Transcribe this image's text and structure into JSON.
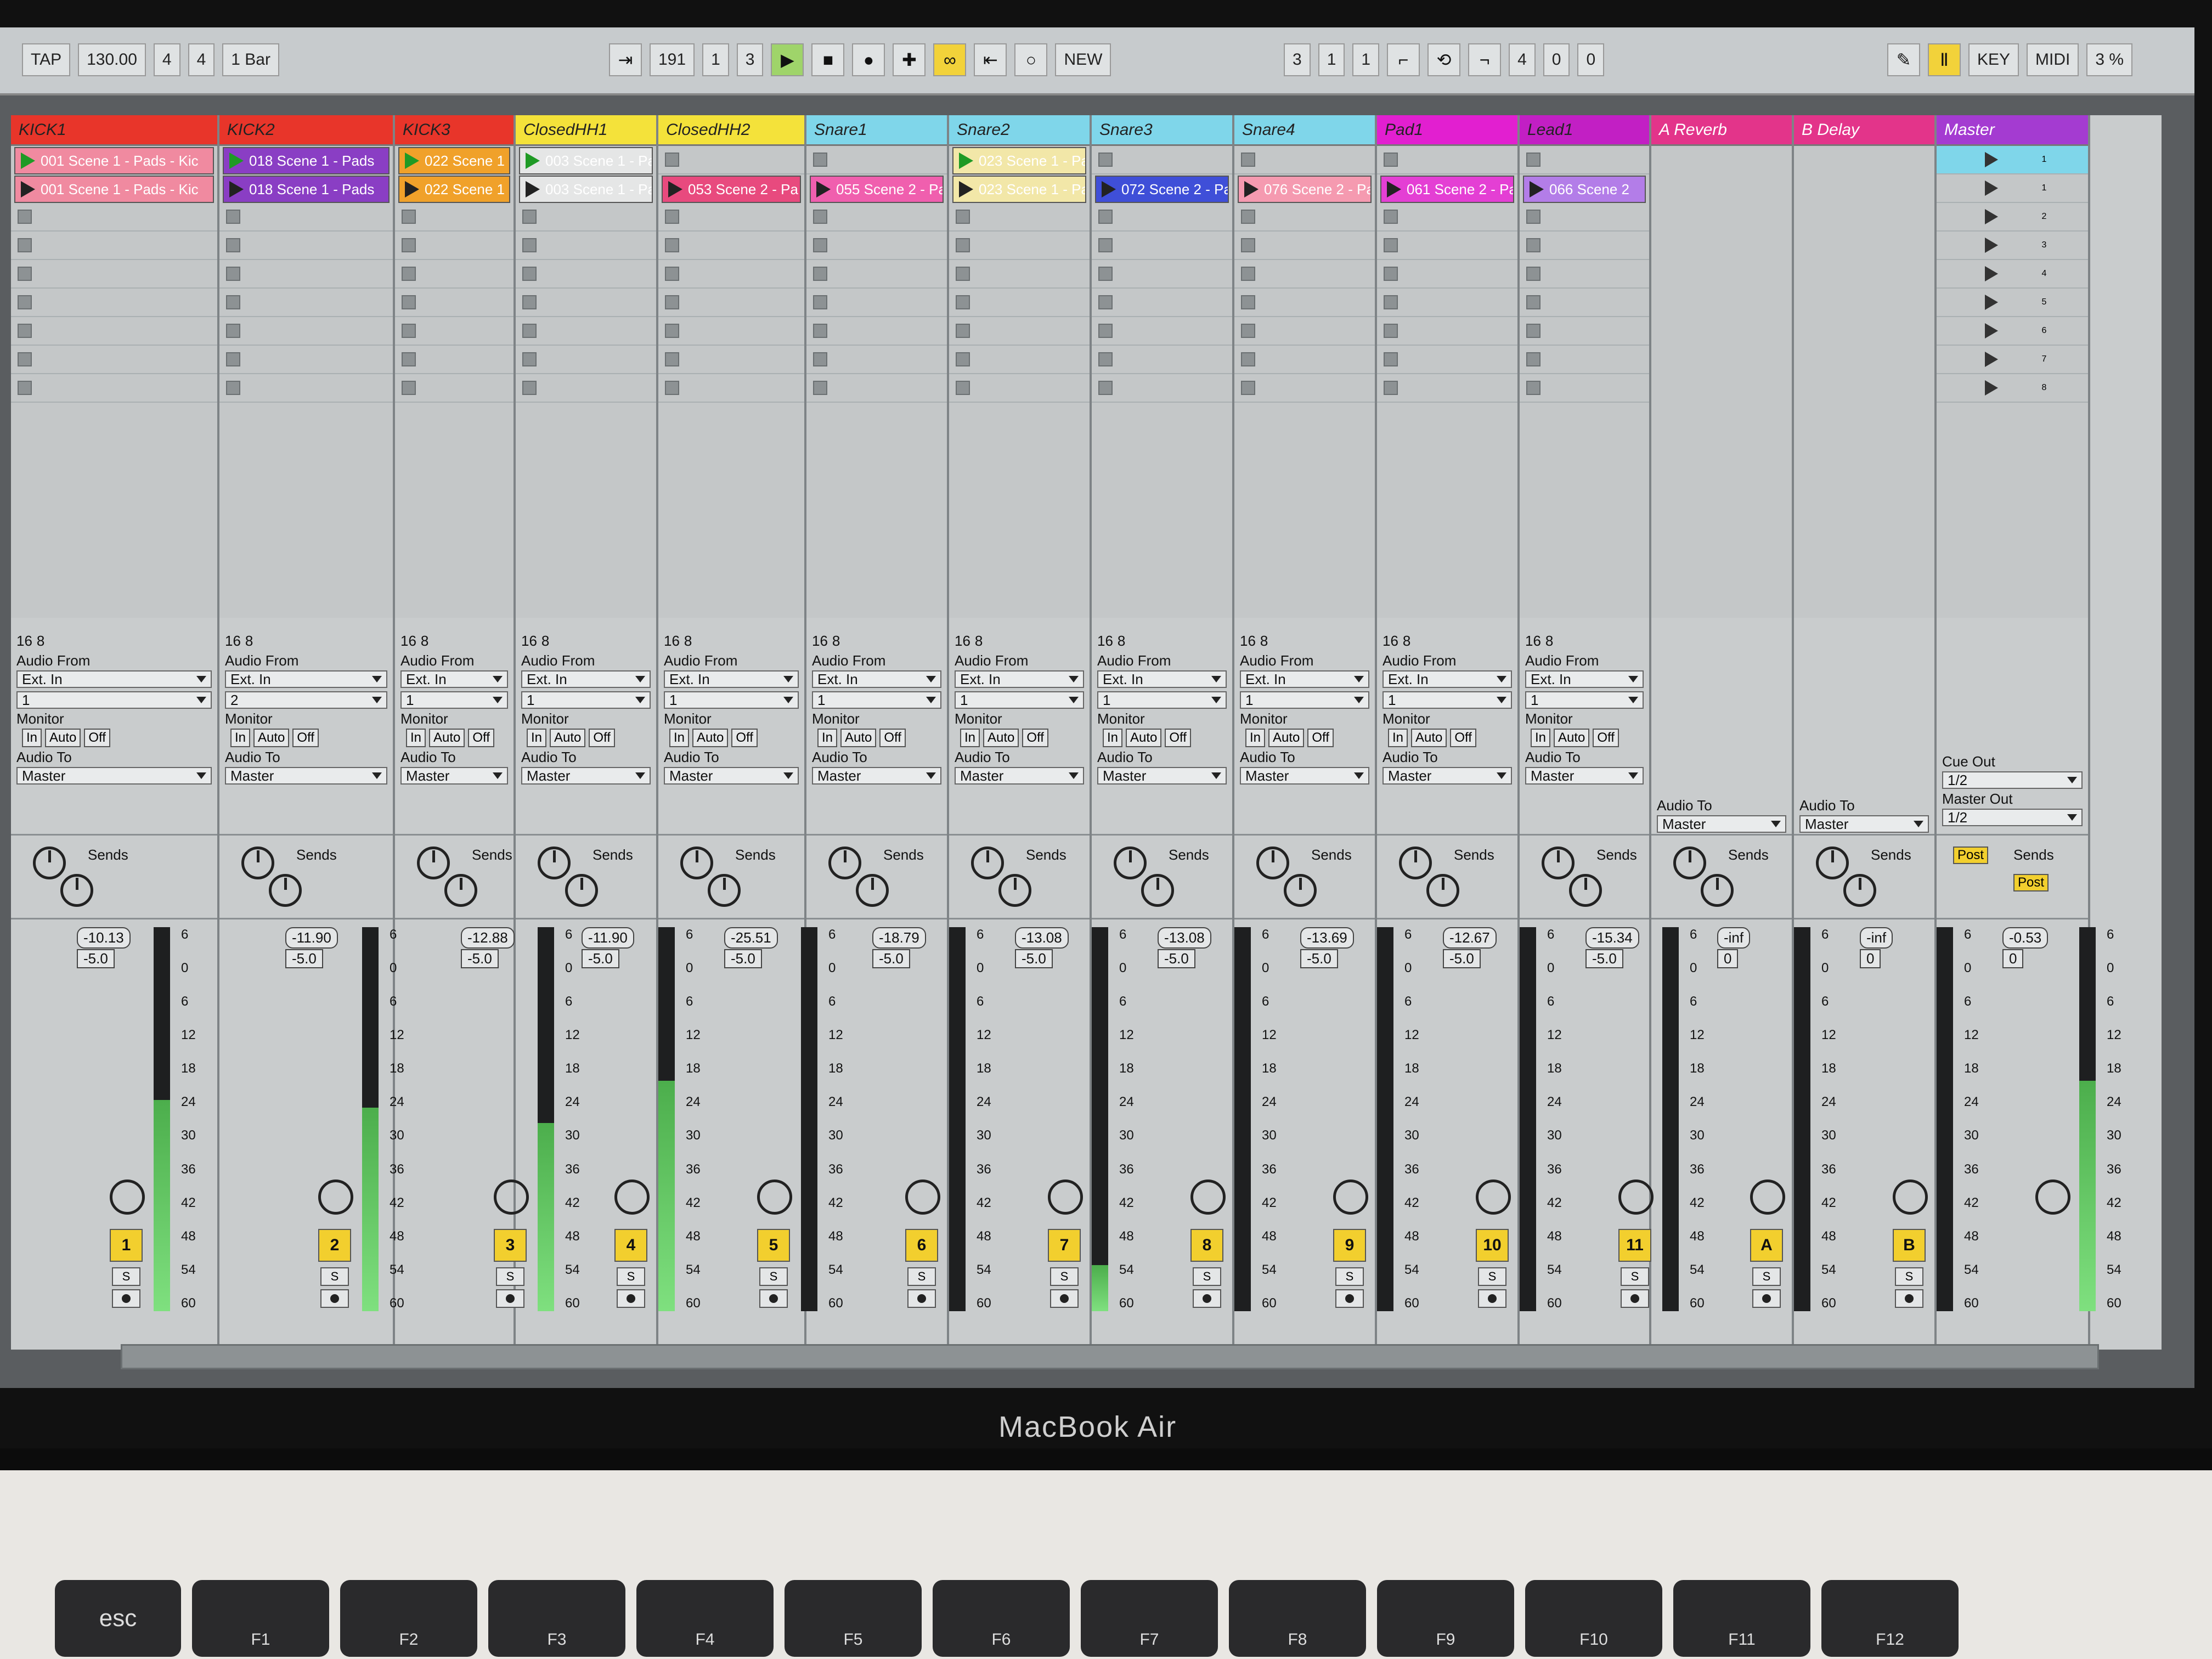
{
  "topbar": {
    "tap": "TAP",
    "tempo": "130.00",
    "signature": [
      "4",
      "4"
    ],
    "quantize": "1 Bar",
    "position": [
      "191",
      "1",
      "3"
    ],
    "new_label": "NEW",
    "loop_start": [
      "3",
      "1",
      "1"
    ],
    "loop_length": [
      "4",
      "0",
      "0"
    ],
    "key_label": "KEY",
    "midi_label": "MIDI",
    "cpu": "3 %"
  },
  "colors": {
    "kick": "#e8352a",
    "hihat": "#f4e23a",
    "snare": "#7fd6ea",
    "pad": "#e21fd0",
    "lead": "#c21fc4",
    "return": "#e3348a",
    "master": "#a43bd1"
  },
  "tracks": [
    {
      "name": "KICK1",
      "color": "#e8352a",
      "clips": [
        "001 Scene 1 - Pads - Kic",
        "001 Scene 1 - Pads - Kic"
      ],
      "clip_colors": [
        "#f08aa0",
        "#f08aa0"
      ],
      "vol": "-10.13",
      "pan": "-5.0",
      "num": "1",
      "meter": 0.55,
      "input": "1"
    },
    {
      "name": "KICK2",
      "color": "#e8352a",
      "clips": [
        "018 Scene 1 - Pads",
        "018 Scene 1 - Pads"
      ],
      "clip_colors": [
        "#8a3ec4",
        "#8a3ec4"
      ],
      "vol": "-11.90",
      "pan": "-5.0",
      "num": "2",
      "meter": 0.53,
      "input": "2"
    },
    {
      "name": "KICK3",
      "color": "#e8352a",
      "clips": [
        "022 Scene 1",
        "022 Scene 1"
      ],
      "clip_colors": [
        "#f0a12a",
        "#f0a12a"
      ],
      "vol": "-12.88",
      "pan": "-5.0",
      "num": "3",
      "meter": 0.49,
      "input": "1"
    },
    {
      "name": "ClosedHH1",
      "color": "#f4e23a",
      "clips": [
        "003 Scene 1 - Pa",
        "003 Scene 1 - Pa"
      ],
      "clip_colors": [
        "#e5e6e6",
        "#e5e6e6"
      ],
      "vol": "-11.90",
      "pan": "-5.0",
      "num": "4",
      "meter": 0.6,
      "input": "1"
    },
    {
      "name": "ClosedHH2",
      "color": "#f4e23a",
      "clips": [
        "",
        "053 Scene 2 - Pa"
      ],
      "clip_colors": [
        "",
        "#e84a7e"
      ],
      "vol": "-25.51",
      "pan": "-5.0",
      "num": "5",
      "meter": 0,
      "input": "1"
    },
    {
      "name": "Snare1",
      "color": "#7fd6ea",
      "clips": [
        "",
        "055 Scene 2 - Pa"
      ],
      "clip_colors": [
        "",
        "#f05fae"
      ],
      "vol": "-18.79",
      "pan": "-5.0",
      "num": "6",
      "meter": 0,
      "input": "1"
    },
    {
      "name": "Snare2",
      "color": "#7fd6ea",
      "clips": [
        "023 Scene 1 - Pa",
        "023 Scene 1 - Pa"
      ],
      "clip_colors": [
        "#f2e7a8",
        "#f2e7a8"
      ],
      "vol": "-13.08",
      "pan": "-5.0",
      "num": "7",
      "meter": 0.12,
      "input": "1"
    },
    {
      "name": "Snare3",
      "color": "#7fd6ea",
      "clips": [
        "",
        "072 Scene 2 - Pa"
      ],
      "clip_colors": [
        "",
        "#3f4fd8"
      ],
      "vol": "-13.08",
      "pan": "-5.0",
      "num": "8",
      "meter": 0,
      "input": "1"
    },
    {
      "name": "Snare4",
      "color": "#7fd6ea",
      "clips": [
        "",
        "076 Scene 2 - Pa"
      ],
      "clip_colors": [
        "",
        "#f59ab0"
      ],
      "vol": "-13.69",
      "pan": "-5.0",
      "num": "9",
      "meter": 0,
      "input": "1"
    },
    {
      "name": "Pad1",
      "color": "#e21fd0",
      "clips": [
        "",
        "061 Scene 2 - Pa"
      ],
      "clip_colors": [
        "",
        "#e43fd4"
      ],
      "vol": "-12.67",
      "pan": "-5.0",
      "num": "10",
      "meter": 0,
      "input": "1"
    },
    {
      "name": "Lead1",
      "color": "#c21fc4",
      "clips": [
        "",
        "066 Scene 2"
      ],
      "clip_colors": [
        "",
        "#b37de8"
      ],
      "vol": "-15.34",
      "pan": "-5.0",
      "num": "11",
      "meter": 0,
      "input": "1"
    }
  ],
  "returns": [
    {
      "name": "A Reverb",
      "vol": "-inf",
      "pan": "0",
      "num": "A"
    },
    {
      "name": "B Delay",
      "vol": "-inf",
      "pan": "0",
      "num": "B"
    }
  ],
  "master": {
    "name": "Master",
    "scenes": [
      "1",
      "1",
      "2",
      "3",
      "4",
      "5",
      "6",
      "7",
      "8"
    ],
    "cue_out_label": "Cue Out",
    "cue_out": "1/2",
    "master_out_label": "Master Out",
    "master_out": "1/2",
    "vol": "-0.53",
    "pan": "0",
    "meter": 0.6
  },
  "labels": {
    "audio_from": "Audio From",
    "ext_in": "Ext. In",
    "monitor": "Monitor",
    "in": "In",
    "auto": "Auto",
    "off": "Off",
    "audio_to": "Audio To",
    "master": "Master",
    "sends": "Sends",
    "post": "Post",
    "solo": "S",
    "midi_top": "16",
    "midi_bot": "8"
  },
  "meter_scale": [
    "6",
    "0",
    "6",
    "12",
    "18",
    "24",
    "30",
    "36",
    "42",
    "48",
    "54",
    "60"
  ],
  "brand": "MacBook Air",
  "keyboard": {
    "keys": [
      "esc",
      "F1",
      "F2",
      "F3",
      "F4",
      "F5",
      "F6",
      "F7",
      "F8",
      "F9",
      "F10",
      "F11",
      "F12"
    ]
  }
}
